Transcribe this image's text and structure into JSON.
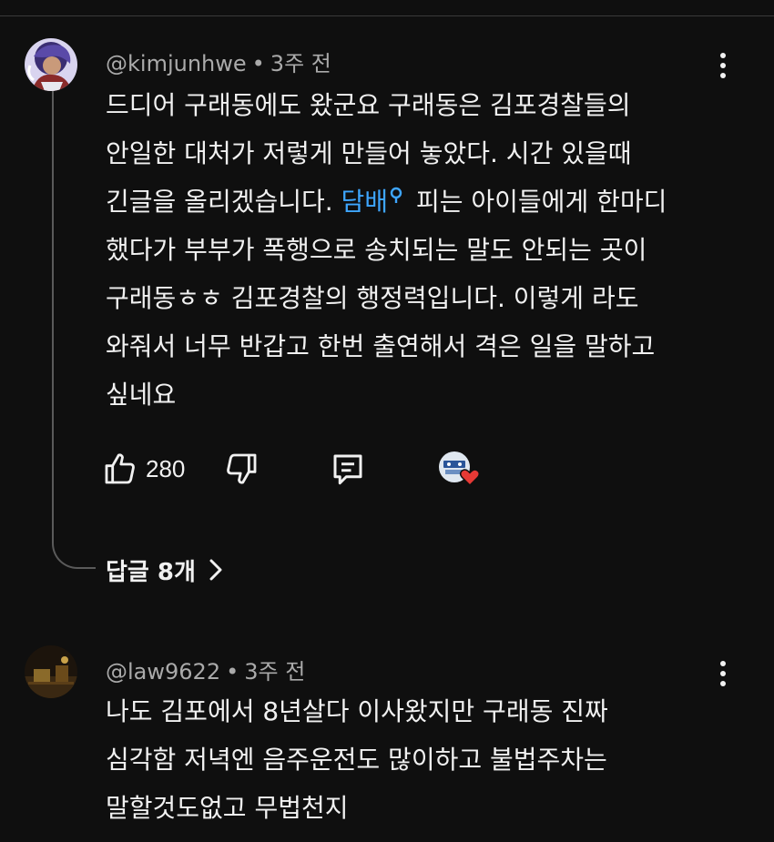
{
  "comments": [
    {
      "author": "@kimjunhwe",
      "time": "3주 전",
      "text_before_link": "드디어 구래동에도 왔군요 구래동은 김포경찰들의\n안일한 대처가 저렇게 만들어 놓았다. 시간 있을때\n긴글을 올리겠습니다. ",
      "link_text": "담배",
      "text_after_link": " 피는 아이들에게 한마디\n했다가 부부가 폭행으로 송치되는 말도 안되는 곳이\n구래동ㅎㅎ 김포경찰의 행정력입니다. 이렇게 라도\n와줘서 너무 반갑고 한번 출연해서 격은 일을 말하고\n싶네요",
      "likes": "280",
      "replies_label": "답글 8개",
      "icons": {
        "like": "thumbs-up-icon",
        "dislike": "thumbs-down-icon",
        "reply": "comment-icon",
        "creator_heart": "heart-icon",
        "more": "more-vert-icon",
        "search": "search-icon",
        "expand": "chevron-right-icon"
      },
      "accent_colors": {
        "link": "#3ea6ff",
        "heart": "#e53935"
      }
    },
    {
      "author": "@law9622",
      "time": "3주 전",
      "text": "나도 김포에서 8년살다 이사왔지만 구래동 진짜\n심각함 저녁엔 음주운전도 많이하고 불법주차는\n말할것도없고 무법천지",
      "icons": {
        "more": "more-vert-icon"
      }
    }
  ]
}
